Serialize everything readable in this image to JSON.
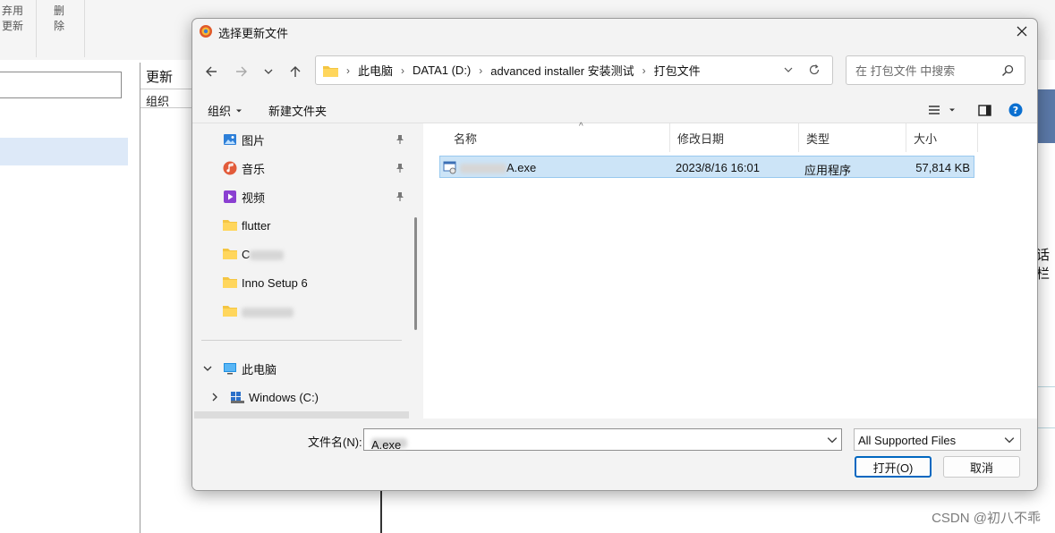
{
  "background": {
    "toolbar": {
      "discard_update": "弃用\n更新",
      "delete": "删\n除"
    },
    "panel": {
      "title": "更新",
      "subtitle": "组织"
    },
    "right_text": "话栏"
  },
  "dialog": {
    "title": "选择更新文件",
    "breadcrumb": [
      "此电脑",
      "DATA1 (D:)",
      "advanced installer 安装测试",
      "打包文件"
    ],
    "search_placeholder": "在 打包文件 中搜索",
    "commands": {
      "organize": "组织",
      "new_folder": "新建文件夹"
    },
    "nav_items": [
      {
        "label": "图片",
        "icon": "pictures-icon",
        "pinned": true
      },
      {
        "label": "音乐",
        "icon": "music-icon",
        "pinned": true
      },
      {
        "label": "视频",
        "icon": "video-icon",
        "pinned": true
      },
      {
        "label": "flutter",
        "icon": "folder-icon",
        "pinned": false
      },
      {
        "label": "C",
        "icon": "folder-icon",
        "pinned": false
      },
      {
        "label": "Inno Setup 6",
        "icon": "folder-icon",
        "pinned": false
      },
      {
        "label": "",
        "icon": "folder-icon",
        "pinned": false
      }
    ],
    "tree": {
      "this_pc": "此电脑",
      "windows_c": "Windows (C:)"
    },
    "columns": {
      "name": "名称",
      "modified": "修改日期",
      "type": "类型",
      "size": "大小"
    },
    "files": [
      {
        "name": "A.exe",
        "modified": "2023/8/16 16:01",
        "type": "应用程序",
        "size": "57,814 KB"
      }
    ],
    "filename_label": "文件名(N):",
    "filename_value": "A.exe",
    "filter": "All Supported Files",
    "open_button": "打开(O)",
    "cancel_button": "取消"
  },
  "watermark": "CSDN @初八不乖",
  "colors": {
    "selection": "#cce4f7",
    "selection_border": "#99c9ef",
    "accent": "#0067c0"
  }
}
